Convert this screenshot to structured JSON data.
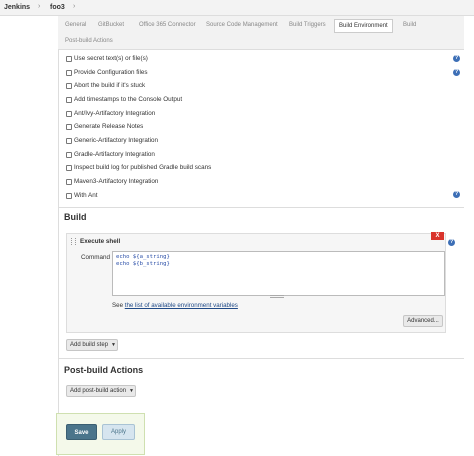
{
  "breadcrumbs": [
    {
      "label": "Jenkins"
    },
    {
      "label": "foo3"
    }
  ],
  "tabs": [
    {
      "label": "General"
    },
    {
      "label": "GitBucket"
    },
    {
      "label": "Office 365 Connector"
    },
    {
      "label": "Source Code Management"
    },
    {
      "label": "Build Triggers"
    },
    {
      "label": "Build Environment",
      "active": true
    },
    {
      "label": "Build"
    },
    {
      "label": "Post-build Actions"
    }
  ],
  "build_environment": {
    "options": [
      {
        "label": "Use secret text(s) or file(s)",
        "checked": false
      },
      {
        "label": "Provide Configuration files",
        "checked": false
      },
      {
        "label": "Abort the build if it's stuck",
        "checked": false
      },
      {
        "label": "Add timestamps to the Console Output",
        "checked": false
      },
      {
        "label": "Ant/Ivy-Artifactory Integration",
        "checked": false
      },
      {
        "label": "Generate Release Notes",
        "checked": false
      },
      {
        "label": "Generic-Artifactory Integration",
        "checked": false
      },
      {
        "label": "Gradle-Artifactory Integration",
        "checked": false
      },
      {
        "label": "Inspect build log for published Gradle build scans",
        "checked": false
      },
      {
        "label": "Maven3-Artifactory Integration",
        "checked": false
      },
      {
        "label": "With Ant",
        "checked": false
      }
    ]
  },
  "build": {
    "title": "Build",
    "step_title": "Execute shell",
    "close_label": "X",
    "command_label": "Command",
    "command_value": "echo ${a_string}\necho ${b_string}",
    "see_prefix": "See ",
    "see_link": "the list of available environment variables",
    "advanced_label": "Advanced...",
    "add_step_label": "Add build step"
  },
  "post_build": {
    "title": "Post-build Actions",
    "add_action_label": "Add post-build action"
  },
  "actions": {
    "save_label": "Save",
    "apply_label": "Apply"
  },
  "help_icon_glyph": "?",
  "colors": {
    "save_button": "#4b758b",
    "close_button": "#d9332b",
    "help_icon": "#3d6fb6",
    "link": "#204a87"
  }
}
